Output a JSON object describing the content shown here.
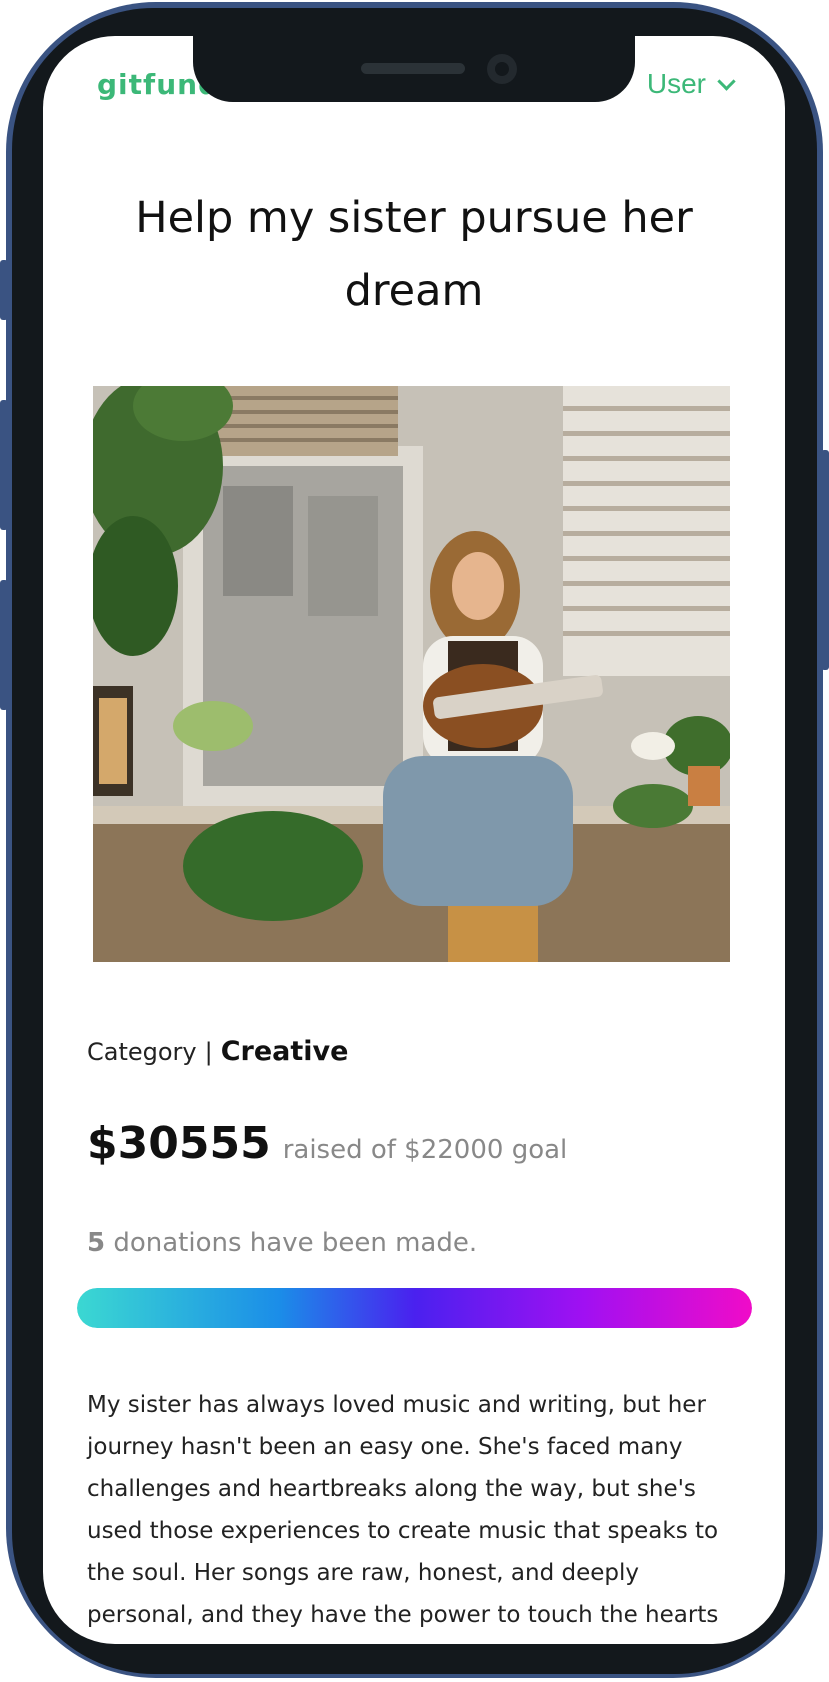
{
  "app": {
    "logo_text": "gitfund",
    "user_menu_label": "User",
    "brand_color": "#3cb878"
  },
  "campaign": {
    "title": "Help my sister pursue her dream",
    "category_label": "Category",
    "category_separator": "|",
    "category_value": "Creative",
    "amount_raised": "$30555",
    "raised_text": "raised of $22000 goal",
    "donations_count": "5",
    "donations_text": "donations have been made.",
    "progress_fraction": 1.0,
    "progress_gradient": [
      "#3bd8d2",
      "#1b8de8",
      "#4a21ef",
      "#a010f2",
      "#f00cc8"
    ],
    "story": "My sister has always loved music and writing, but her journey hasn't been an easy one. She's faced many challenges and heartbreaks along the way, but she's used those experiences to create music that speaks to the soul. Her songs are raw, honest, and deeply personal, and they have the power to touch the hearts"
  },
  "icons": {
    "user_menu_caret": "chevron-down-icon"
  }
}
